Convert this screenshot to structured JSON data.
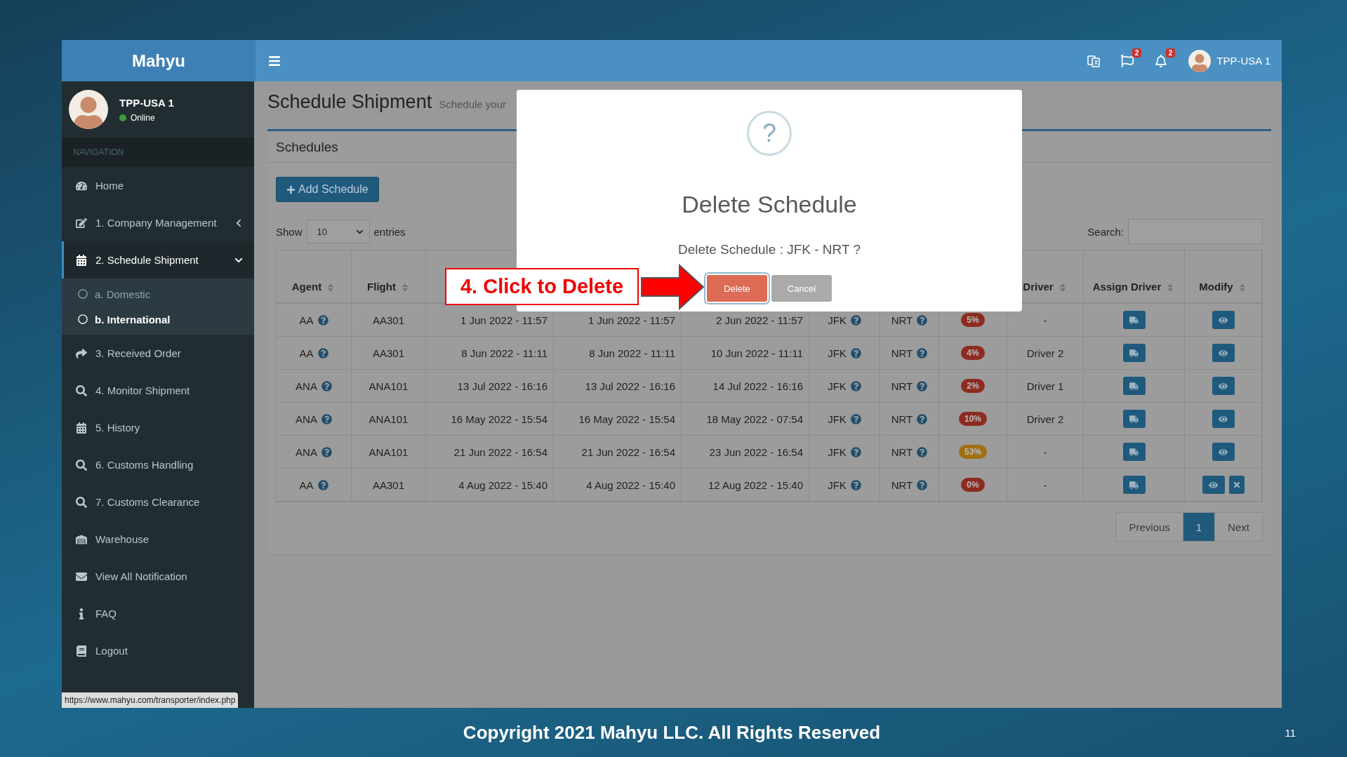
{
  "app": {
    "logo": "Mahyu",
    "user": {
      "name": "TPP-USA 1",
      "status": "Online"
    }
  },
  "top_bar": {
    "flag_badge": "2",
    "bell_badge": "2",
    "user": "TPP-USA 1"
  },
  "sidebar": {
    "header": "NAVIGATION",
    "items": [
      {
        "label": "Home",
        "selected": false
      },
      {
        "label": "1. Company Management",
        "selected": false,
        "expanded": false
      },
      {
        "label": "2. Schedule Shipment",
        "selected": true,
        "expanded": true,
        "children": [
          {
            "label": "a. Domestic",
            "selected": false
          },
          {
            "label": "b. International",
            "selected": true
          }
        ]
      },
      {
        "label": "3. Received Order",
        "selected": false
      },
      {
        "label": "4. Monitor Shipment",
        "selected": false
      },
      {
        "label": "5. History",
        "selected": false
      },
      {
        "label": "6. Customs Handling",
        "selected": false
      },
      {
        "label": "7. Customs Clearance",
        "selected": false
      },
      {
        "label": "Warehouse",
        "selected": false
      },
      {
        "label": "View All Notification",
        "selected": false
      },
      {
        "label": "FAQ",
        "selected": false
      },
      {
        "label": "Logout",
        "selected": false
      }
    ]
  },
  "page": {
    "title": "Schedule Shipment",
    "subtitle": "Schedule your",
    "box_title": "Schedules",
    "add_button": "Add Schedule",
    "show_label": "Show",
    "page_size": "10",
    "entries_label": "entries",
    "search_label": "Search:"
  },
  "table": {
    "columns": {
      "agent": "Agent",
      "flight": "Flight",
      "driver": "Driver",
      "assign_driver": "Assign Driver",
      "modify": "Modify"
    },
    "rows": [
      {
        "agent": "AA",
        "flight": "AA301",
        "time_1": "1 Jun 2022 - 11:57",
        "time_2": "1 Jun 2022 - 11:57",
        "time_3": "2 Jun 2022 - 11:57",
        "origin": "JFK",
        "destination": "NRT",
        "progress": "5%",
        "color": "#8e2b20",
        "driver": "-",
        "deletable": false
      },
      {
        "agent": "AA",
        "flight": "AA301",
        "time_1": "8 Jun 2022 - 11:11",
        "time_2": "8 Jun 2022 - 11:11",
        "time_3": "10 Jun 2022 - 11:11",
        "origin": "JFK",
        "destination": "NRT",
        "progress": "4%",
        "color": "#8e2b20",
        "driver": "Driver 2",
        "deletable": false
      },
      {
        "agent": "ANA",
        "flight": "ANA101",
        "time_1": "13 Jul 2022 - 16:16",
        "time_2": "13 Jul 2022 - 16:16",
        "time_3": "14 Jul 2022 - 16:16",
        "origin": "JFK",
        "destination": "NRT",
        "progress": "2%",
        "color": "#8e2b20",
        "driver": "Driver 1",
        "deletable": false
      },
      {
        "agent": "ANA",
        "flight": "ANA101",
        "time_1": "16 May 2022 - 15:54",
        "time_2": "16 May 2022 - 15:54",
        "time_3": "18 May 2022 - 07:54",
        "origin": "JFK",
        "destination": "NRT",
        "progress": "10%",
        "color": "#8e2b20",
        "driver": "Driver 2",
        "deletable": false
      },
      {
        "agent": "ANA",
        "flight": "ANA101",
        "time_1": "21 Jun 2022 - 16:54",
        "time_2": "21 Jun 2022 - 16:54",
        "time_3": "23 Jun 2022 - 16:54",
        "origin": "JFK",
        "destination": "NRT",
        "progress": "53%",
        "color": "#a06f12",
        "driver": "-",
        "deletable": false
      },
      {
        "agent": "AA",
        "flight": "AA301",
        "time_1": "4 Aug 2022 - 15:40",
        "time_2": "4 Aug 2022 - 15:40",
        "time_3": "12 Aug 2022 - 15:40",
        "origin": "JFK",
        "destination": "NRT",
        "progress": "0%",
        "color": "#8e2b20",
        "driver": "-",
        "deletable": true
      }
    ]
  },
  "pagination": {
    "previous": "Previous",
    "pages": [
      {
        "label": "1",
        "selected": true
      }
    ],
    "next": "Next"
  },
  "dialog": {
    "symbol": "?",
    "title": "Delete Schedule",
    "message": "Delete Schedule : JFK - NRT ?",
    "confirm": "Delete",
    "cancel": "Cancel"
  },
  "callout": "4. Click to Delete",
  "status_url": "https://www.mahyu.com/transporter/index.php",
  "slide": {
    "footer": "Copyright 2021 Mahyu LLC. All Rights Reserved",
    "page_number": "11"
  }
}
